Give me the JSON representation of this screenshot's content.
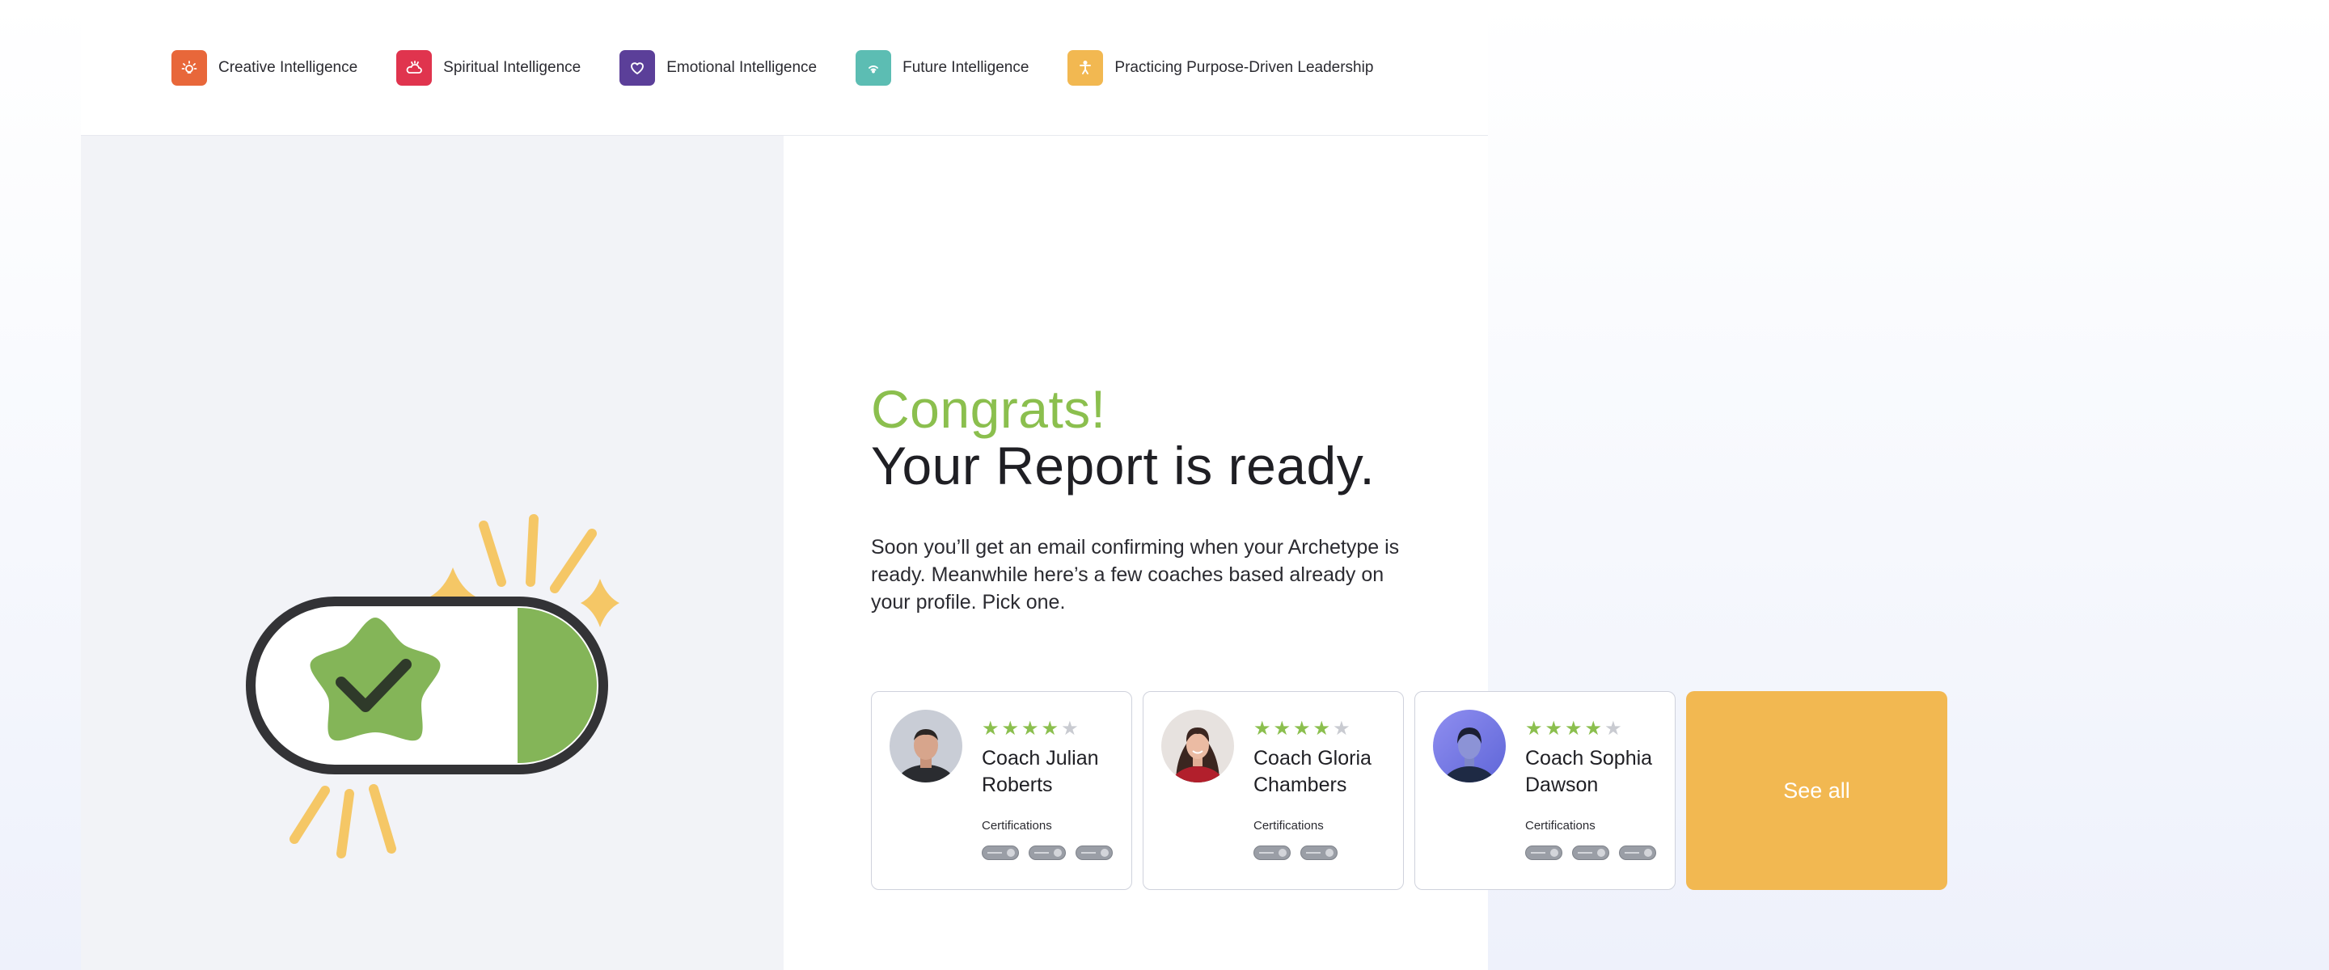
{
  "nav": {
    "items": [
      {
        "label": "Creative Intelligence",
        "icon": "lightbulb-icon",
        "color": "#e8673a"
      },
      {
        "label": "Spiritual Intelligence",
        "icon": "cloud-sun-icon",
        "color": "#e0344e"
      },
      {
        "label": "Emotional Intelligence",
        "icon": "heart-icon",
        "color": "#5b3f99"
      },
      {
        "label": "Future Intelligence",
        "icon": "signal-icon",
        "color": "#5cbdb3"
      },
      {
        "label": "Practicing Purpose-Driven Leadership",
        "icon": "person-icon",
        "color": "#f2b851"
      }
    ]
  },
  "hero": {
    "congrats": "Congrats!",
    "headline": "Your Report is ready.",
    "body": "Soon you’ll get an email confirming when your Archetype is ready. Meanwhile here’s a few coaches based already on your profile. Pick one."
  },
  "coaches": [
    {
      "name": "Coach Julian Roberts",
      "rating": 4,
      "cert_label": "Certifications",
      "badge_count": 3
    },
    {
      "name": "Coach Gloria Chambers",
      "rating": 4,
      "cert_label": "Certifications",
      "badge_count": 2
    },
    {
      "name": "Coach Sophia Dawson",
      "rating": 4,
      "cert_label": "Certifications",
      "badge_count": 3
    }
  ],
  "see_all_label": "See all",
  "colors": {
    "accent_green": "#8bbf4e",
    "accent_yellow": "#f2b851",
    "panel_gray": "#f2f3f7"
  }
}
